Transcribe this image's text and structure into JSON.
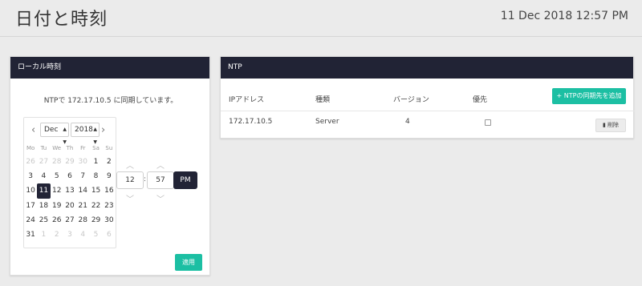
{
  "header": {
    "title": "日付と時刻",
    "datetime": "11 Dec 2018 12:57 PM"
  },
  "local_time": {
    "title": "ローカル時刻",
    "sync_message": "NTPで 172.17.10.5 に同期しています。",
    "calendar": {
      "prev_icon": "chevron-left-icon",
      "next_icon": "chevron-right-icon",
      "month": "Dec",
      "year": "2018",
      "weekdays": [
        "Mo",
        "Tu",
        "We",
        "Th",
        "Fr",
        "Sa",
        "Su"
      ],
      "weeks": [
        [
          "26",
          "27",
          "28",
          "29",
          "30",
          "1",
          "2"
        ],
        [
          "3",
          "4",
          "5",
          "6",
          "7",
          "8",
          "9"
        ],
        [
          "10",
          "11",
          "12",
          "13",
          "14",
          "15",
          "16"
        ],
        [
          "17",
          "18",
          "19",
          "20",
          "21",
          "22",
          "23"
        ],
        [
          "24",
          "25",
          "26",
          "27",
          "28",
          "29",
          "30"
        ],
        [
          "31",
          "1",
          "2",
          "3",
          "4",
          "5",
          "6"
        ]
      ],
      "selected_day": "11"
    },
    "time": {
      "hour": "12",
      "minute": "57",
      "separator": ":",
      "ampm": "PM",
      "up_icon": "chevron-up-icon",
      "down_icon": "chevron-down-icon"
    },
    "apply_label": "適用"
  },
  "ntp": {
    "title": "NTP",
    "add_button_label": "+ NTPの同期先を追加",
    "columns": {
      "ip": "IPアドレス",
      "type": "種類",
      "version": "バージョン",
      "prefer": "優先"
    },
    "rows": [
      {
        "ip": "172.17.10.5",
        "type": "Server",
        "version": "4",
        "prefer": false,
        "delete_label": "削除"
      }
    ],
    "delete_icon": "trash-icon"
  },
  "colors": {
    "header_dark": "#212335",
    "accent_teal": "#1cbfa3",
    "background": "#ebebeb"
  }
}
